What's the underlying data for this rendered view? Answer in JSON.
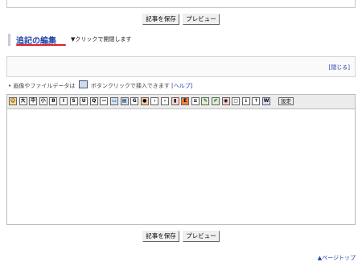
{
  "top_buttons": {
    "save": "記事を保存",
    "preview": "プレビュー"
  },
  "section": {
    "title": "追記の編集",
    "hint": "▼クリックで開閉します"
  },
  "close_link": "[閉じる]",
  "note": {
    "bullet": "•",
    "before": "画像やファイルデータは",
    "after": "ボタンクリックで挿入できます",
    "help": "[ヘルプ]"
  },
  "toolbar": {
    "buttons": [
      {
        "name": "emoji-icon",
        "label": "☺",
        "bg": "#ffe08a"
      },
      {
        "name": "font-large-icon",
        "label": "大",
        "bg": "#ffffff"
      },
      {
        "name": "font-medium-icon",
        "label": "中",
        "bg": "#ffffff"
      },
      {
        "name": "font-small-icon",
        "label": "小",
        "bg": "#ffffff"
      },
      {
        "name": "bold-icon",
        "label": "B",
        "bg": "#ffffff"
      },
      {
        "name": "italic-icon",
        "label": "I",
        "bg": "#ffffff"
      },
      {
        "name": "strike-icon",
        "label": "S",
        "bg": "#ffffff"
      },
      {
        "name": "underline-icon",
        "label": "U",
        "bg": "#ffffff"
      },
      {
        "name": "quote-icon",
        "label": "Q",
        "bg": "#ffffff"
      },
      {
        "name": "hr-icon",
        "label": "—",
        "bg": "#ffffff"
      },
      {
        "name": "image-icon",
        "label": "▭",
        "bg": "#cfe6ff"
      },
      {
        "name": "file-icon",
        "label": "▤",
        "bg": "#cfe6ff"
      },
      {
        "name": "google-icon",
        "label": "G",
        "bg": "#ffffff"
      },
      {
        "name": "user-icon",
        "label": "●",
        "bg": "#ffd0a0"
      },
      {
        "name": "align-left-icon",
        "label": "‹",
        "bg": "#ffffff"
      },
      {
        "name": "align-right-icon",
        "label": "›",
        "bg": "#ffffff"
      },
      {
        "name": "trash-icon",
        "label": "▮",
        "bg": "#ffd8d0"
      },
      {
        "name": "e-icon",
        "label": "E",
        "bg": "#ff8040"
      },
      {
        "name": "list-icon",
        "label": "≡",
        "bg": "#ffffff"
      },
      {
        "name": "note-icon",
        "label": "✎",
        "bg": "#d8f0d0"
      },
      {
        "name": "pencil-icon",
        "label": "✐",
        "bg": "#d8f0d0"
      },
      {
        "name": "camera-icon",
        "label": "◉",
        "bg": "#ffd0d0"
      },
      {
        "name": "box-icon",
        "label": "▢",
        "bg": "#ffffff"
      },
      {
        "name": "down-icon",
        "label": "↓",
        "bg": "#ffffff"
      },
      {
        "name": "up-icon",
        "label": "↑",
        "bg": "#ffffff"
      },
      {
        "name": "wikipedia-icon",
        "label": "W",
        "bg": "#d8e0ff"
      }
    ],
    "settings": "設定"
  },
  "bottom_buttons": {
    "save": "記事を保存",
    "preview": "プレビュー"
  },
  "page_top": "▲ページトップ"
}
